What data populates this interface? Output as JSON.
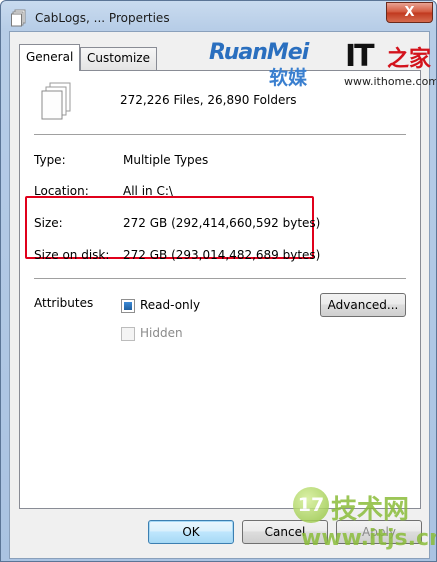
{
  "window": {
    "title": "CabLogs, ... Properties",
    "close_label": "X"
  },
  "tabs": [
    {
      "label": "General",
      "active": true
    },
    {
      "label": "Customize",
      "active": false
    }
  ],
  "general": {
    "summary": "272,226 Files, 26,890 Folders",
    "type_label": "Type:",
    "type_value": "Multiple Types",
    "location_label": "Location:",
    "location_value": "All in C:\\",
    "size_label": "Size:",
    "size_value": "272 GB (292,414,660,592 bytes)",
    "size_on_disk_label": "Size on disk:",
    "size_on_disk_value": "272 GB (293,014,482,689 bytes)",
    "attributes_label": "Attributes",
    "readonly_label": "Read-only",
    "readonly_checked": true,
    "hidden_label": "Hidden",
    "hidden_checked": false,
    "advanced_label": "Advanced..."
  },
  "buttons": {
    "ok": "OK",
    "cancel": "Cancel",
    "apply": "Apply"
  },
  "watermarks": {
    "ruanmei": "RuanMei",
    "ruanmei_cn": "软媒",
    "it": "IT",
    "it_cn": "之家",
    "ithome_url": "www.ithome.com",
    "jishu_badge": "17",
    "jishu_cn": "技术网",
    "itjs_url": "www.itjs.cn"
  },
  "colors": {
    "highlight": "#e0001b",
    "titlebar": "#b7cde7",
    "close_button": "#c0381e"
  },
  "icons": {
    "title": "folder-files-icon",
    "summary": "multiple-files-icon"
  }
}
